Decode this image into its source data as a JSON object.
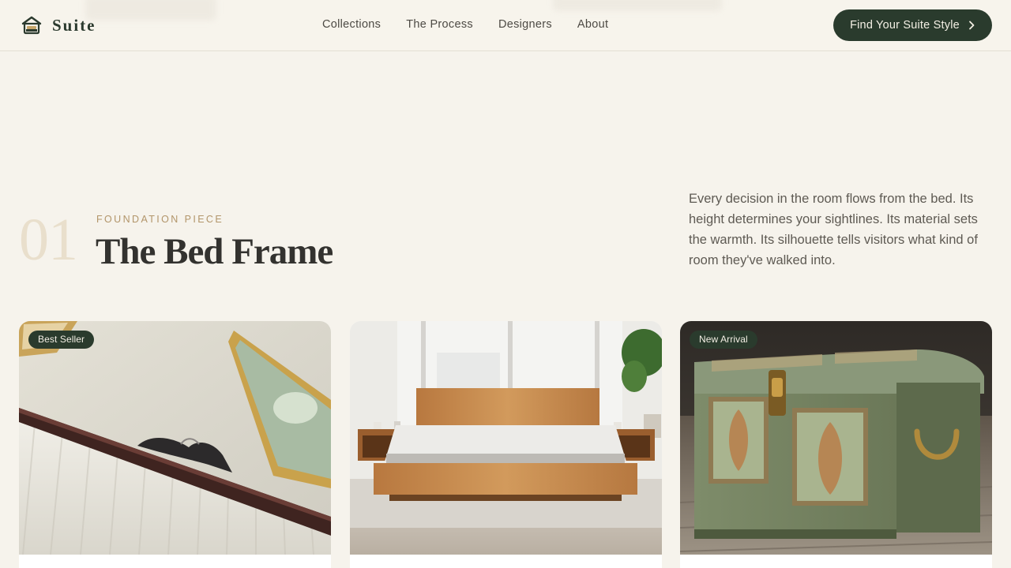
{
  "brand": {
    "name": "Suite",
    "logo_icon": "bed-house-icon"
  },
  "nav": {
    "items": [
      {
        "label": "Collections"
      },
      {
        "label": "The Process"
      },
      {
        "label": "Designers"
      },
      {
        "label": "About"
      }
    ]
  },
  "cta": {
    "label": "Find Your Suite Style",
    "icon": "chevron-right-icon"
  },
  "section": {
    "number": "01",
    "eyebrow": "FOUNDATION PIECE",
    "title": "The Bed Frame",
    "description": "Every decision in the room flows from the bed. Its height determines your sightlines. Its material sets the warmth. Its silhouette tells visitors what kind of room they've walked into."
  },
  "products": [
    {
      "badge": "Best Seller",
      "image": "ornate upholstered headboard"
    },
    {
      "badge": "",
      "image": "oak platform bed with nightstands"
    },
    {
      "badge": "New Arrival",
      "image": "painted green storage chest"
    }
  ],
  "colors": {
    "accent": "#2a3b2d",
    "background": "#f6f3ec",
    "eyebrow": "#b2956a",
    "number": "#e9dfcc"
  }
}
